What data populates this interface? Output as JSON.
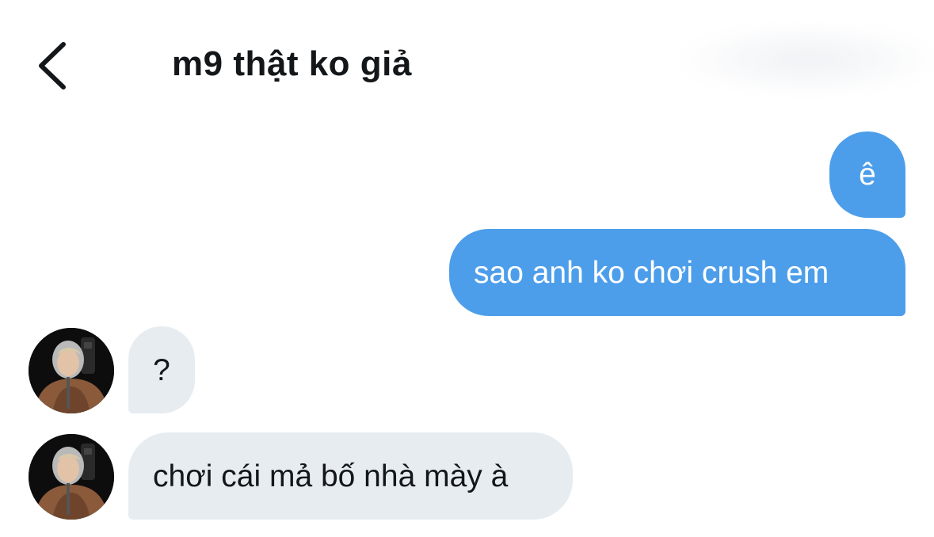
{
  "header": {
    "back_icon": "chevron-left-icon",
    "title": "m9 thật ko giả"
  },
  "messages": [
    {
      "direction": "sent",
      "text": "ê"
    },
    {
      "direction": "sent",
      "text": "sao anh ko chơi crush em"
    },
    {
      "direction": "received",
      "text": "?",
      "avatar": "avatar"
    },
    {
      "direction": "received",
      "text": "chơi cái mả bố nhà mày à",
      "avatar": "avatar"
    }
  ],
  "colors": {
    "sent_bubble": "#4d9eea",
    "received_bubble": "#e6ecf0",
    "text_dark": "#14171a",
    "background": "#ffffff"
  }
}
